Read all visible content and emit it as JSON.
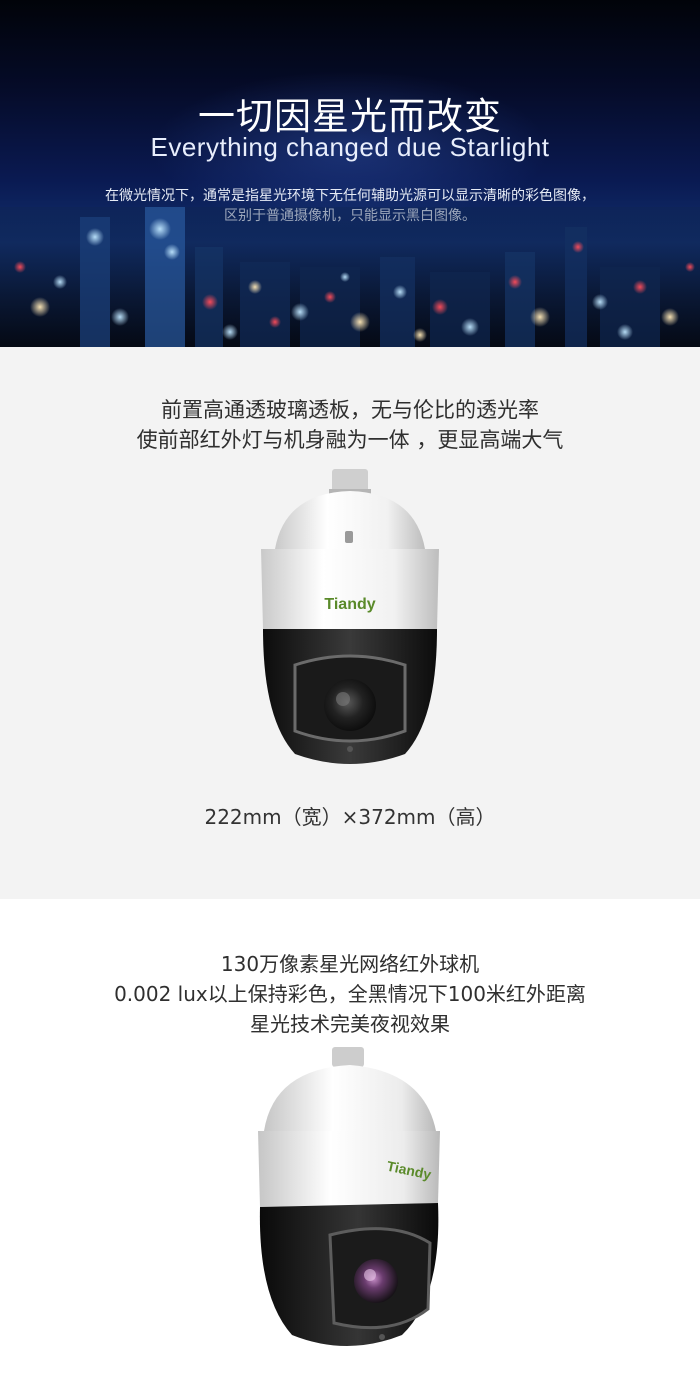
{
  "hero": {
    "title": "一切因星光而改变",
    "subtitle": "Everything changed due Starlight",
    "desc_line1": "在微光情况下，通常是指星光环境下无任何辅助光源可以显示清晰的彩色图像，",
    "desc_line2": "区别于普通摄像机，只能显示黑白图像。"
  },
  "section2": {
    "line1": "前置高通透玻璃透板，无与伦比的透光率",
    "line2": "使前部红外灯与机身融为一体 ，更显高端大气",
    "camera_brand": "Tiandy",
    "dimensions": "222mm（宽）×372mm（高）"
  },
  "section3": {
    "line1": "130万像素星光网络红外球机",
    "line2": "0.002 lux以上保持彩色，全黑情况下100米红外距离",
    "line3": "星光技术完美夜视效果",
    "camera_brand": "Tiandy"
  },
  "colors": {
    "brand_green": "#5a8a2a",
    "section_gray": "#f3f3f3"
  }
}
